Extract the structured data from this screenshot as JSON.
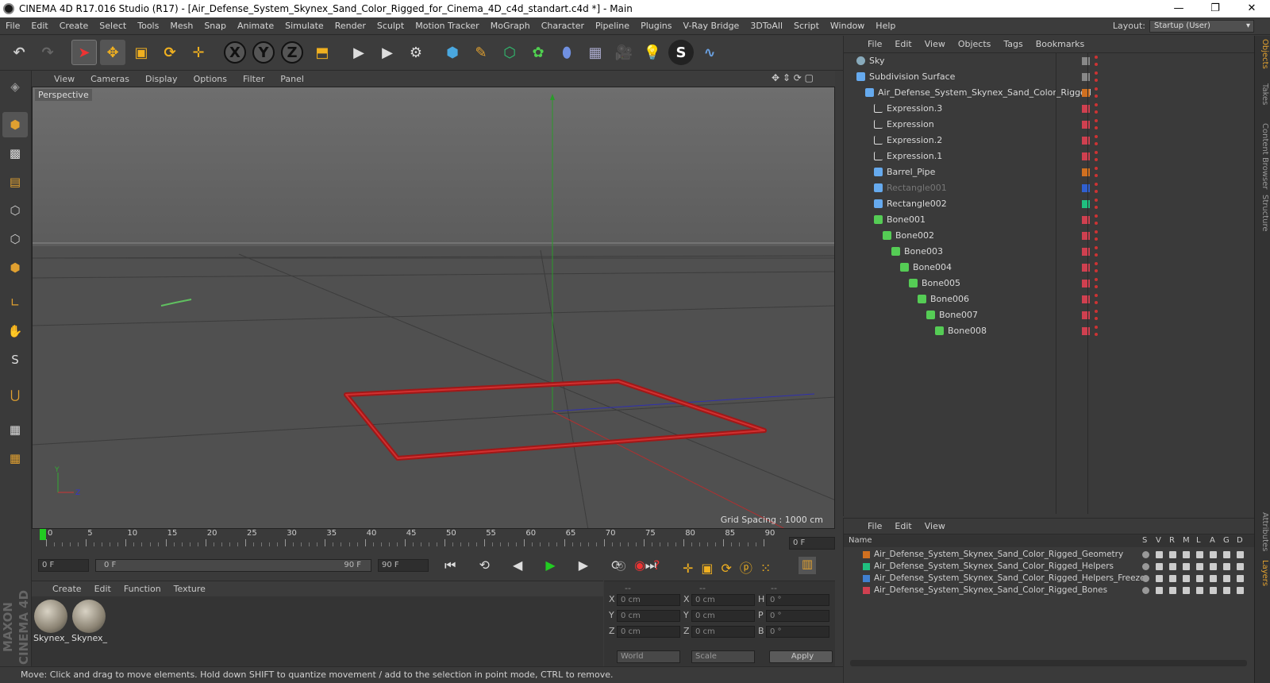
{
  "window": {
    "title": "CINEMA 4D R17.016 Studio (R17) - [Air_Defense_System_Skynex_Sand_Color_Rigged_for_Cinema_4D_c4d_standart.c4d *] - Main",
    "minimize": "—",
    "maximize": "❐",
    "close": "✕"
  },
  "menubar": {
    "items": [
      "File",
      "Edit",
      "Create",
      "Select",
      "Tools",
      "Mesh",
      "Snap",
      "Animate",
      "Simulate",
      "Render",
      "Sculpt",
      "Motion Tracker",
      "MoGraph",
      "Character",
      "Pipeline",
      "Plugins",
      "V-Ray Bridge",
      "3DToAll",
      "Script",
      "Window",
      "Help"
    ],
    "layout_label": "Layout:",
    "layout_value": "Startup (User)"
  },
  "toolbar": {
    "axis_x": "X",
    "axis_y": "Y",
    "axis_z": "Z"
  },
  "viewport": {
    "menu": [
      "View",
      "Cameras",
      "Display",
      "Options",
      "Filter",
      "Panel"
    ],
    "label": "Perspective",
    "grid_spacing": "Grid Spacing : 1000 cm"
  },
  "timeline": {
    "ticks": [
      "0",
      "5",
      "10",
      "15",
      "20",
      "25",
      "30",
      "35",
      "40",
      "45",
      "50",
      "55",
      "60",
      "65",
      "70",
      "75",
      "80",
      "85",
      "90"
    ],
    "frame_field": "0 F"
  },
  "transport": {
    "start": "0 F",
    "range_start": "0 F",
    "range_end": "90 F",
    "end": "90 F"
  },
  "materials": {
    "menu": [
      "Create",
      "Edit",
      "Function",
      "Texture"
    ],
    "items": [
      {
        "label": "Skynex_"
      },
      {
        "label": "Skynex_"
      }
    ]
  },
  "coordinates": {
    "header": [
      "--",
      "--",
      "--"
    ],
    "rows": [
      {
        "l1": "X",
        "v1": "0 cm",
        "l2": "X",
        "v2": "0 cm",
        "l3": "H",
        "v3": "0 °"
      },
      {
        "l1": "Y",
        "v1": "0 cm",
        "l2": "Y",
        "v2": "0 cm",
        "l3": "P",
        "v3": "0 °"
      },
      {
        "l1": "Z",
        "v1": "0 cm",
        "l2": "Z",
        "v2": "0 cm",
        "l3": "B",
        "v3": "0 °"
      }
    ],
    "world": "World",
    "scale": "Scale",
    "apply": "Apply"
  },
  "status": "Move: Click and drag to move elements. Hold down SHIFT to quantize movement / add to the selection in point mode, CTRL to remove.",
  "objects": {
    "menu": [
      "File",
      "Edit",
      "View",
      "Objects",
      "Tags",
      "Bookmarks"
    ],
    "items": [
      {
        "name": "Sky",
        "indent": 0,
        "color": "#888888"
      },
      {
        "name": "Subdivision Surface",
        "indent": 0,
        "color": "#888888"
      },
      {
        "name": "Air_Defense_System_Skynex_Sand_Color_Rigged",
        "indent": 1,
        "color": "#d07020"
      },
      {
        "name": "Expression.3",
        "indent": 2,
        "color": "#d04050"
      },
      {
        "name": "Expression",
        "indent": 2,
        "color": "#d04050"
      },
      {
        "name": "Expression.2",
        "indent": 2,
        "color": "#d04050"
      },
      {
        "name": "Expression.1",
        "indent": 2,
        "color": "#d04050"
      },
      {
        "name": "Barrel_Pipe",
        "indent": 2,
        "color": "#d07020"
      },
      {
        "name": "Rectangle001",
        "indent": 2,
        "color": "#3060d0"
      },
      {
        "name": "Rectangle002",
        "indent": 2,
        "color": "#20c080"
      },
      {
        "name": "Bone001",
        "indent": 2,
        "color": "#d04050"
      },
      {
        "name": "Bone002",
        "indent": 3,
        "color": "#d04050"
      },
      {
        "name": "Bone003",
        "indent": 4,
        "color": "#d04050"
      },
      {
        "name": "Bone004",
        "indent": 5,
        "color": "#d04050"
      },
      {
        "name": "Bone005",
        "indent": 6,
        "color": "#d04050"
      },
      {
        "name": "Bone006",
        "indent": 7,
        "color": "#d04050"
      },
      {
        "name": "Bone007",
        "indent": 8,
        "color": "#d04050"
      },
      {
        "name": "Bone008",
        "indent": 9,
        "color": "#d04050"
      }
    ]
  },
  "layers": {
    "menu": [
      "File",
      "Edit",
      "View"
    ],
    "columns": [
      "Name",
      "S",
      "V",
      "R",
      "M",
      "L",
      "A",
      "G",
      "D"
    ],
    "items": [
      {
        "name": "Air_Defense_System_Skynex_Sand_Color_Rigged_Geometry",
        "color": "#d07020"
      },
      {
        "name": "Air_Defense_System_Skynex_Sand_Color_Rigged_Helpers",
        "color": "#20c080"
      },
      {
        "name": "Air_Defense_System_Skynex_Sand_Color_Rigged_Helpers_Freeze",
        "color": "#4080d0"
      },
      {
        "name": "Air_Defense_System_Skynex_Sand_Color_Rigged_Bones",
        "color": "#d04050"
      }
    ]
  },
  "side_tabs": [
    "Objects",
    "Takes",
    "Content Browser",
    "Structure",
    "Attributes",
    "Layers"
  ]
}
